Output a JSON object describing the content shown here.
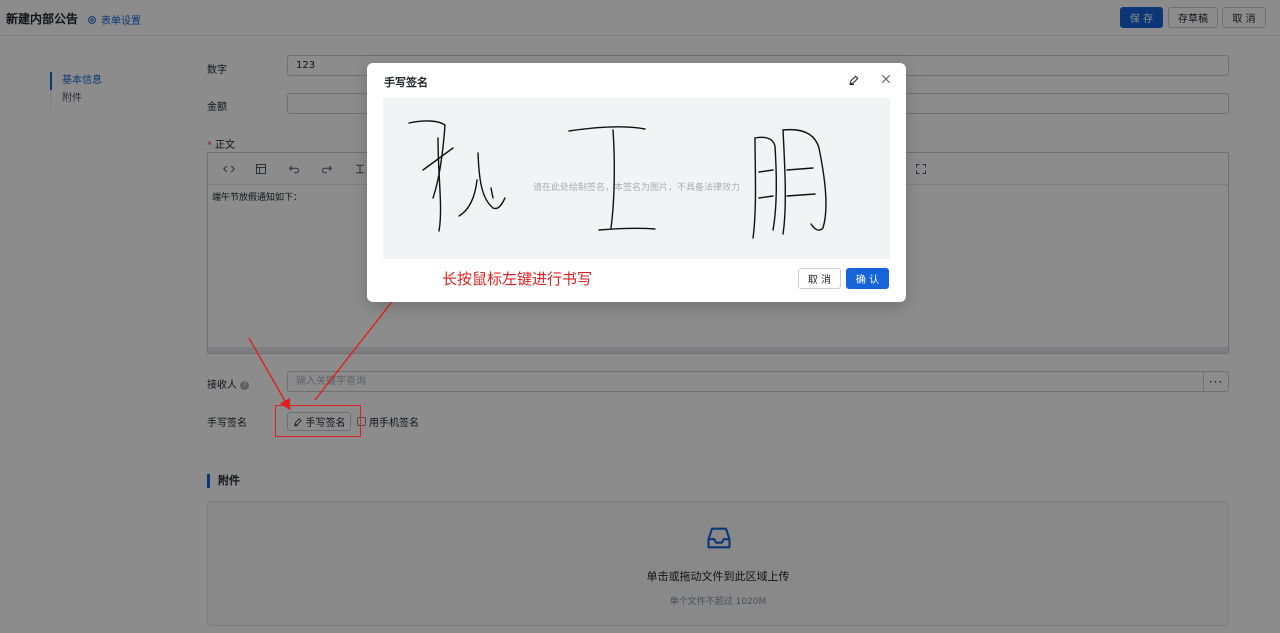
{
  "header": {
    "title": "新建内部公告",
    "form_settings": "表单设置",
    "save": "保 存",
    "draft": "存草稿",
    "cancel": "取 消"
  },
  "nav": {
    "items": [
      {
        "label": "基本信息",
        "active": true
      },
      {
        "label": "附件",
        "active": false
      }
    ]
  },
  "form": {
    "number": {
      "label": "数字",
      "value": "123"
    },
    "amount": {
      "label": "金额",
      "value": ""
    },
    "body": {
      "label": "正文",
      "required": true,
      "content": "端午节放假通知如下："
    },
    "recipient": {
      "label": "接收人",
      "placeholder": "输入关键字查询",
      "more": "···"
    },
    "signature": {
      "label": "手写签名",
      "button": "手写签名",
      "phone_option": "用手机签名"
    }
  },
  "attachments": {
    "title": "附件",
    "upload_text": "单击或拖动文件到此区域上传",
    "upload_hint": "单个文件不超过 1020M"
  },
  "modal": {
    "title": "手写签名",
    "canvas_hint": "请在此处绘制签名，本签名为图片，不具备法律效力",
    "cancel": "取 消",
    "confirm": "确 认"
  },
  "annotation": {
    "text": "长按鼠标左键进行书写",
    "color": "#e02020"
  },
  "colors": {
    "primary": "#1664d9",
    "overlay": "rgba(0,0,0,0.45)"
  }
}
